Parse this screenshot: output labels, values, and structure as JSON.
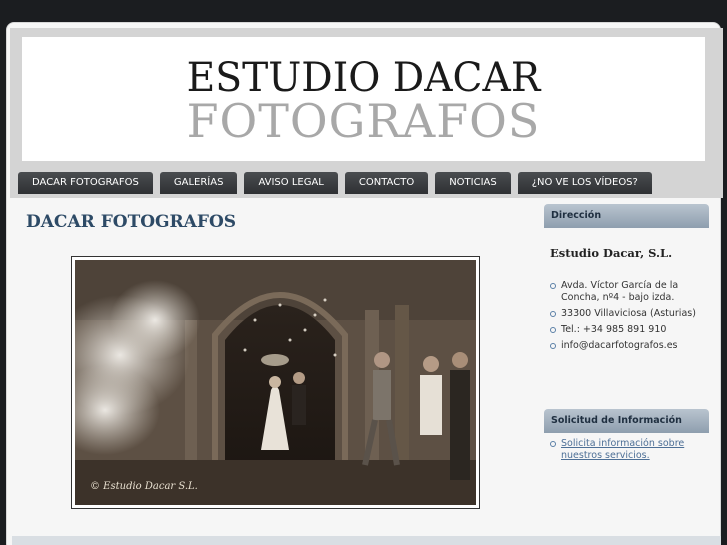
{
  "logo": {
    "line1": "ESTUDIO DACAR",
    "line2": "FOTOGRAFOS"
  },
  "nav": {
    "items": [
      "DACAR FOTOGRAFOS",
      "GALERÍAS",
      "AVISO LEGAL",
      "CONTACTO",
      "NOTICIAS",
      "¿NO VE LOS VÍDEOS?"
    ]
  },
  "main": {
    "title": "DACAR FOTOGRAFOS",
    "photo_caption": "© Estudio Dacar S.L."
  },
  "sidebar": {
    "address_heading": "Dirección",
    "company": "Estudio Dacar, S.L.",
    "address_lines": [
      "Avda. Víctor García de la Concha, nº4 - bajo izda.",
      "33300 Villaviciosa (Asturias)",
      "Tel.: +34 985 891 910",
      "info@dacarfotografos.es"
    ],
    "info_heading": "Solicitud de Información",
    "info_link": "Solicita información sobre nuestros servicios."
  }
}
